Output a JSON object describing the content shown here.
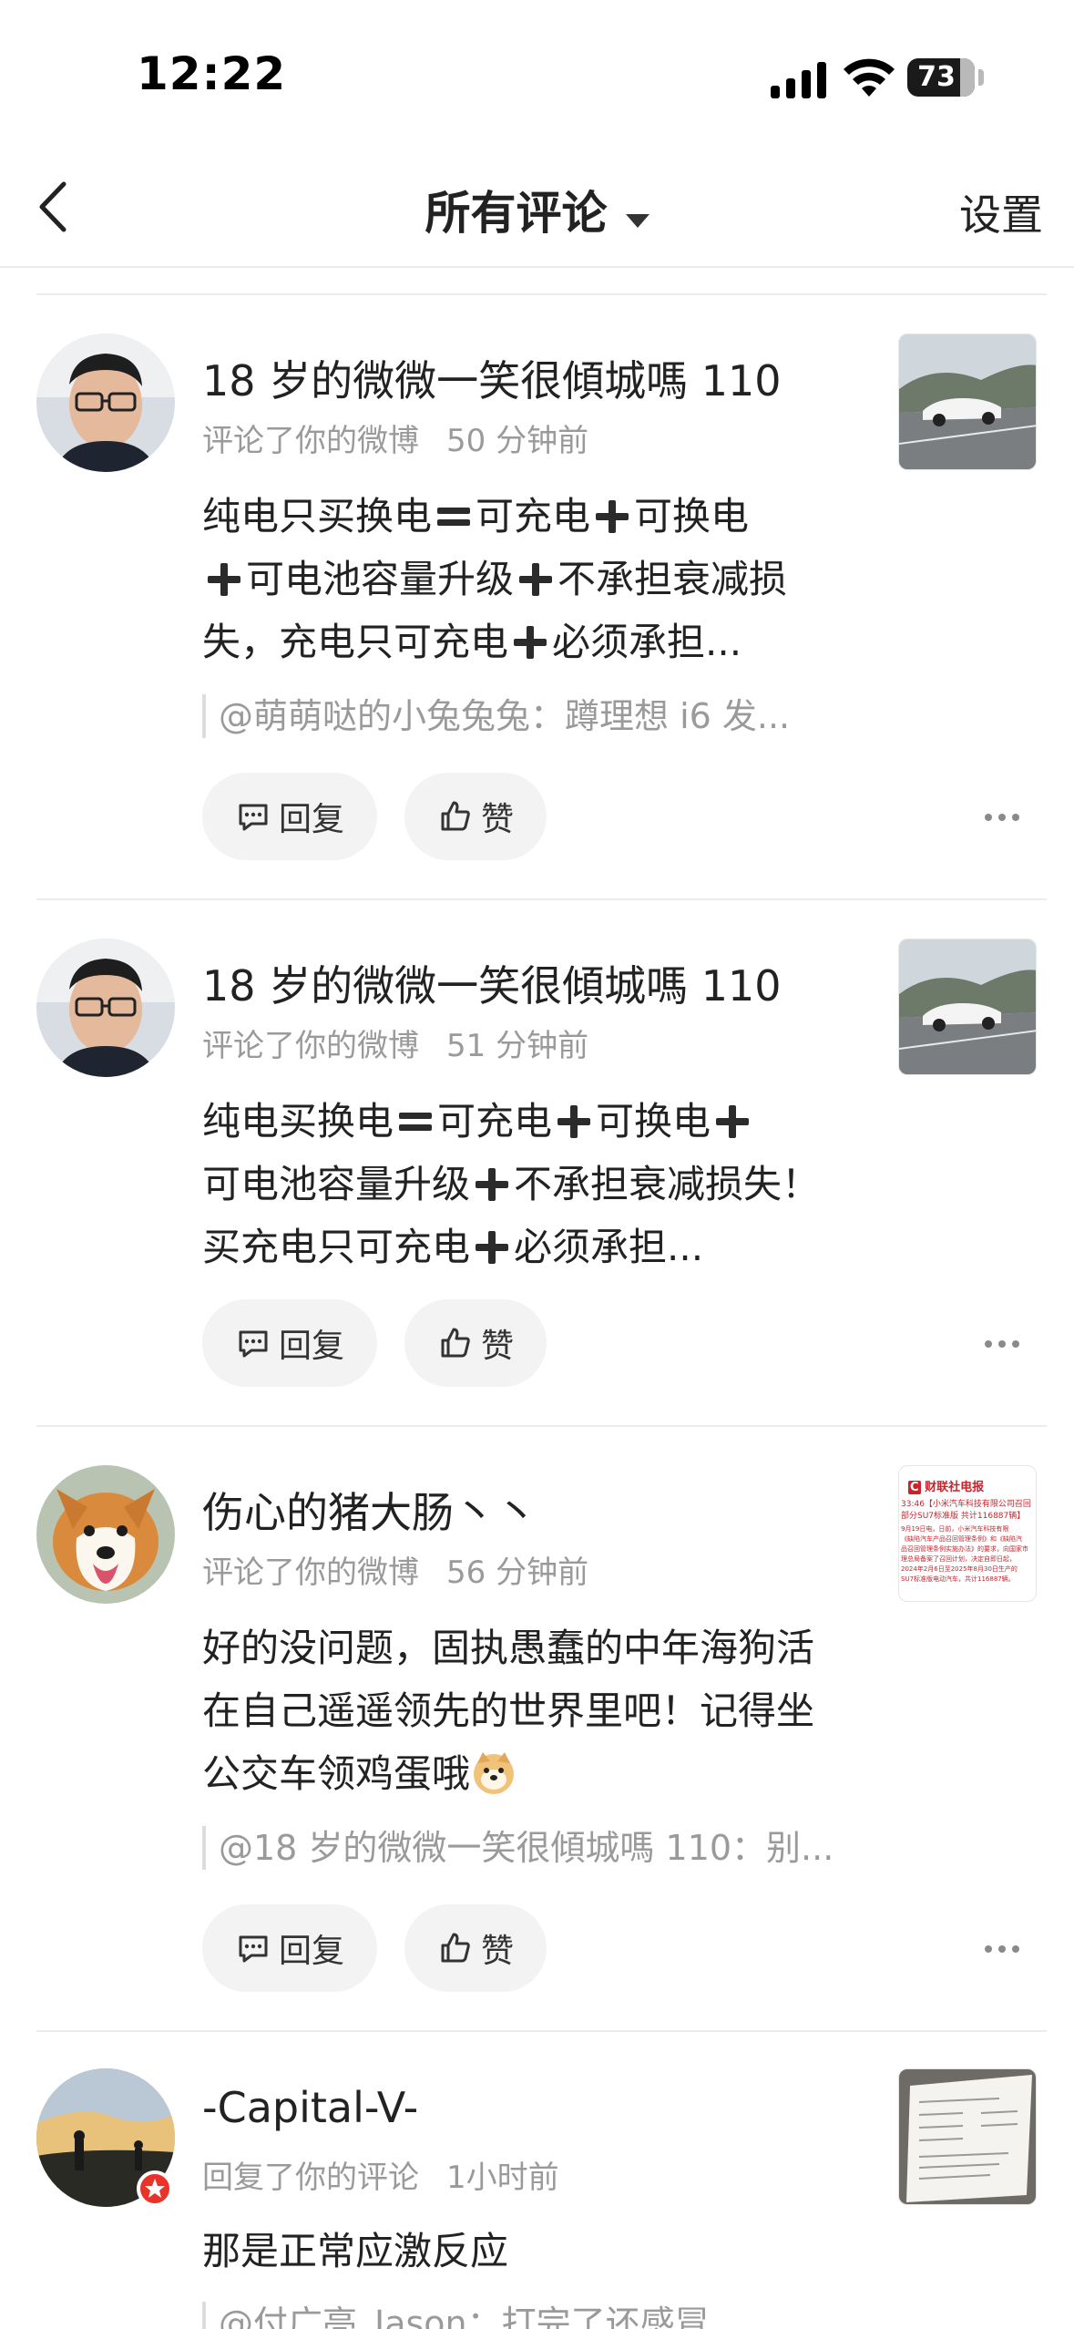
{
  "status_bar": {
    "time": "12:22",
    "battery": "73"
  },
  "nav": {
    "title": "所有评论",
    "settings_label": "设置"
  },
  "comments": [
    {
      "name": "18 岁的微微一笑很傾城嗎 110",
      "action": "评论了你的微博",
      "time": "50 分钟前",
      "body_segments": [
        "纯电只买换电",
        "可充电",
        "可换电",
        "可电池容量升级",
        "不承担衰减损失，充电只可充电",
        "必须承担..."
      ],
      "quote": "@萌萌哒的小兔兔兔：蹲理想 i6 发...",
      "reply_label": "回复",
      "like_label": "赞"
    },
    {
      "name": "18 岁的微微一笑很傾城嗎 110",
      "action": "评论了你的微博",
      "time": "51 分钟前",
      "body_segments": [
        "纯电买换电",
        "可充电",
        "可换电",
        "可电池容量升级",
        "不承担衰减损失！ 买充电只可充电",
        "必须承担..."
      ],
      "reply_label": "回复",
      "like_label": "赞"
    },
    {
      "name": "伤心的猪大肠丶丶",
      "action": "评论了你的微博",
      "time": "56 分钟前",
      "body": "好的没问题，固执愚蠢的中年海狗活在自己遥遥领先的世界里吧！记得坐公交车领鸡蛋哦",
      "quote": "@18 岁的微微一笑很傾城嗎 110：别...",
      "reply_label": "回复",
      "like_label": "赞",
      "thumb_text": {
        "brand": "财联社",
        "brand_suffix": "电报",
        "headline": "33:46【小米汽车科技有限公司召回部分SU7标准版 共计116887辆】",
        "lines": [
          "9月19日电，日前，小米汽车科技有限",
          "《缺陷汽车产品召回管理条例》和《缺陷汽",
          "品召回管理条例实施办法》的要求，向国家市",
          "理总局备案了召回计划，决定自即日起，",
          "2024年2月6日至2025年8月30日生产的",
          "SU7标准版电动汽车，共计116887辆。"
        ]
      }
    },
    {
      "name": "-Capital-V-",
      "action": "回复了你的评论",
      "time": "1小时前",
      "body": "那是正常应激反应",
      "quote": "@付广亮_Jason：打完了还感冒"
    }
  ]
}
